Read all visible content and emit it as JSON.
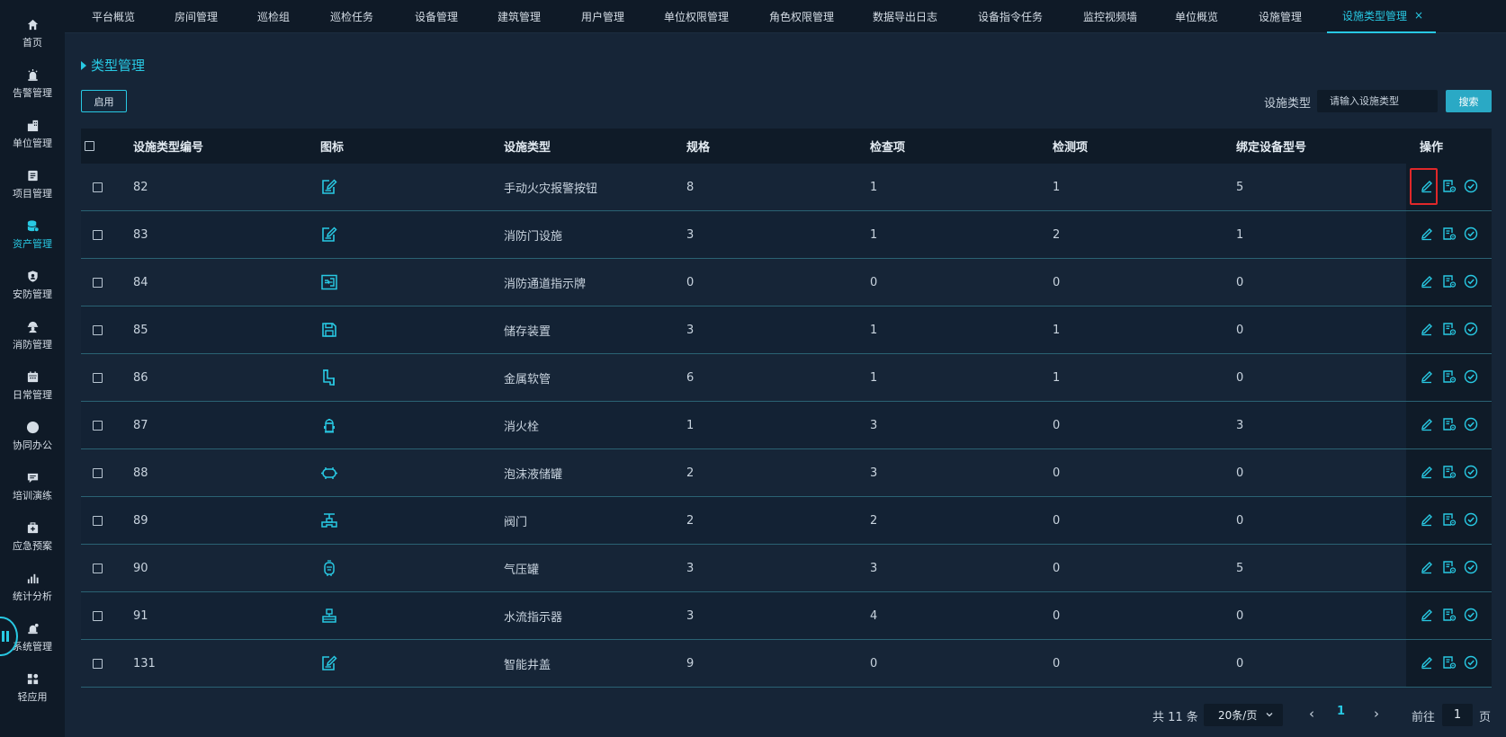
{
  "sidebar": {
    "items": [
      {
        "label": "首页",
        "icon": "home-icon"
      },
      {
        "label": "告警管理",
        "icon": "alarm-icon"
      },
      {
        "label": "单位管理",
        "icon": "building-icon"
      },
      {
        "label": "项目管理",
        "icon": "project-icon"
      },
      {
        "label": "资产管理",
        "icon": "database-icon",
        "active": true
      },
      {
        "label": "安防管理",
        "icon": "shield-icon"
      },
      {
        "label": "消防管理",
        "icon": "firefighter-icon"
      },
      {
        "label": "日常管理",
        "icon": "calendar-icon"
      },
      {
        "label": "协同办公",
        "icon": "circle-icon"
      },
      {
        "label": "培训演练",
        "icon": "chat-icon"
      },
      {
        "label": "应急预案",
        "icon": "kit-icon"
      },
      {
        "label": "统计分析",
        "icon": "bar-chart-icon"
      },
      {
        "label": "系统管理",
        "icon": "system-icon"
      },
      {
        "label": "轻应用",
        "icon": "apps-icon"
      }
    ]
  },
  "tabs": [
    {
      "label": "平台概览"
    },
    {
      "label": "房间管理"
    },
    {
      "label": "巡检组"
    },
    {
      "label": "巡检任务"
    },
    {
      "label": "设备管理"
    },
    {
      "label": "建筑管理"
    },
    {
      "label": "用户管理"
    },
    {
      "label": "单位权限管理"
    },
    {
      "label": "角色权限管理"
    },
    {
      "label": "数据导出日志"
    },
    {
      "label": "设备指令任务"
    },
    {
      "label": "监控视频墙"
    },
    {
      "label": "单位概览"
    },
    {
      "label": "设施管理"
    },
    {
      "label": "设施类型管理",
      "active": true,
      "close": "×"
    }
  ],
  "page_title": "类型管理",
  "toolbar": {
    "enable_label": "启用",
    "search_label": "设施类型",
    "search_placeholder": "请输入设施类型",
    "search_button": "搜索"
  },
  "table": {
    "headers": {
      "id": "设施类型编号",
      "icon": "图标",
      "type": "设施类型",
      "spec": "规格",
      "check": "检查项",
      "detect": "检测项",
      "model": "绑定设备型号",
      "ops": "操作"
    },
    "rows": [
      {
        "id": "82",
        "icon": "edit-doc-icon",
        "type": "手动火灾报警按钮",
        "spec": "8",
        "check": "1",
        "detect": "1",
        "model": "5"
      },
      {
        "id": "83",
        "icon": "edit-doc-icon",
        "type": "消防门设施",
        "spec": "3",
        "check": "1",
        "detect": "2",
        "model": "1"
      },
      {
        "id": "84",
        "icon": "exit-sign-icon",
        "type": "消防通道指示牌",
        "spec": "0",
        "check": "0",
        "detect": "0",
        "model": "0"
      },
      {
        "id": "85",
        "icon": "save-icon",
        "type": "储存装置",
        "spec": "3",
        "check": "1",
        "detect": "1",
        "model": "0"
      },
      {
        "id": "86",
        "icon": "pipe-icon",
        "type": "金属软管",
        "spec": "6",
        "check": "1",
        "detect": "1",
        "model": "0"
      },
      {
        "id": "87",
        "icon": "hydrant-icon",
        "type": "消火栓",
        "spec": "1",
        "check": "3",
        "detect": "0",
        "model": "3"
      },
      {
        "id": "88",
        "icon": "tank-icon",
        "type": "泡沫液储罐",
        "spec": "2",
        "check": "3",
        "detect": "0",
        "model": "0"
      },
      {
        "id": "89",
        "icon": "valve-icon",
        "type": "阀门",
        "spec": "2",
        "check": "2",
        "detect": "0",
        "model": "0"
      },
      {
        "id": "90",
        "icon": "pressure-tank-icon",
        "type": "气压罐",
        "spec": "3",
        "check": "3",
        "detect": "0",
        "model": "5"
      },
      {
        "id": "91",
        "icon": "flow-indicator-icon",
        "type": "水流指示器",
        "spec": "3",
        "check": "4",
        "detect": "0",
        "model": "0"
      },
      {
        "id": "131",
        "icon": "edit-doc-icon",
        "type": "智能井盖",
        "spec": "9",
        "check": "0",
        "detect": "0",
        "model": "0"
      }
    ]
  },
  "pagination": {
    "total": "共 11 条",
    "page_size": "20条/页",
    "prev": "‹",
    "current": "1",
    "next": "›",
    "goto_label": "前往",
    "goto_value": "1",
    "page_suffix": "页"
  },
  "colors": {
    "accent": "#28c9e3",
    "highlight": "#e0282a"
  }
}
